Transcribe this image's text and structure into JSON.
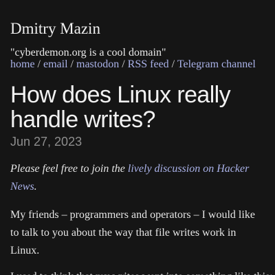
{
  "header": {
    "site_title": "Dmitry Mazin",
    "tagline": "\"cyberdemon.org is a cool domain\"",
    "nav": [
      {
        "label": "home"
      },
      {
        "label": "email"
      },
      {
        "label": "mastodon"
      },
      {
        "label": "RSS feed"
      },
      {
        "label": "Telegram channel"
      }
    ],
    "separator": " / "
  },
  "post": {
    "title": "How does Linux really handle writes?",
    "date": "Jun 27, 2023",
    "intro_before": "Please feel free to join the ",
    "intro_link": "lively discussion on Hacker News",
    "intro_after": ".",
    "paragraph_1": "My friends – programmers and operators – I would like to talk to you about the way that file writes work in Linux.",
    "paragraph_2": "I used to think that my writes went into something like this:"
  },
  "colors": {
    "background": "#151515",
    "link": "#aab2e8",
    "date": "#8e8e8e"
  }
}
